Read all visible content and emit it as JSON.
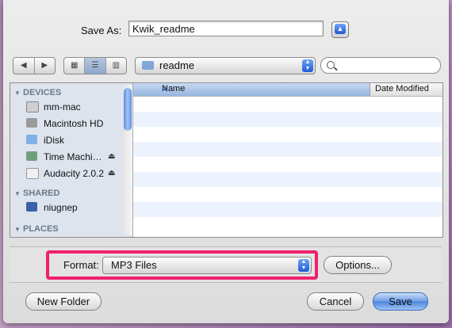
{
  "save": {
    "label": "Save As:",
    "filename": "Kwik_readme"
  },
  "toolbar": {
    "back_icon": "left-triangle",
    "forward_icon": "right-triangle",
    "folder": "readme"
  },
  "sidebar": {
    "sections": [
      {
        "title": "DEVICES",
        "items": [
          {
            "label": "mm-mac",
            "icon": "computer-icon"
          },
          {
            "label": "Macintosh HD",
            "icon": "hard-drive-icon"
          },
          {
            "label": "iDisk",
            "icon": "idisk-icon"
          },
          {
            "label": "Time Machi…",
            "icon": "time-machine-icon",
            "eject": "⏏"
          },
          {
            "label": "Audacity 2.0.2",
            "icon": "disk-image-icon",
            "eject": "⏏"
          }
        ]
      },
      {
        "title": "SHARED",
        "items": [
          {
            "label": "niugnep",
            "icon": "network-computer-icon"
          }
        ]
      },
      {
        "title": "PLACES",
        "items": []
      }
    ]
  },
  "columns": {
    "name": "Name",
    "date": "Date Modified"
  },
  "format": {
    "label": "Format:",
    "value": "MP3 Files",
    "options_button": "Options..."
  },
  "buttons": {
    "new_folder": "New Folder",
    "cancel": "Cancel",
    "save": "Save"
  },
  "colors": {
    "highlight": "#f0206c",
    "accent": "#4a86df"
  }
}
